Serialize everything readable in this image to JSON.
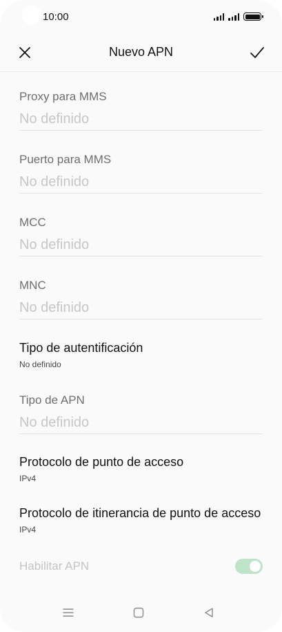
{
  "status_bar": {
    "time": "10:00"
  },
  "app_bar": {
    "title": "Nuevo APN",
    "close_icon": "close-icon",
    "confirm_icon": "check-icon"
  },
  "fields": [
    {
      "label": "Proxy para MMS",
      "placeholder": "No definido"
    },
    {
      "label": "Puerto para MMS",
      "placeholder": "No definido"
    },
    {
      "label": "MCC",
      "placeholder": "No definido"
    },
    {
      "label": "MNC",
      "placeholder": "No definido"
    }
  ],
  "auth_type": {
    "label": "Tipo de autentificación",
    "value": "No definido"
  },
  "apn_type": {
    "label": "Tipo de APN",
    "placeholder": "No definido"
  },
  "protocol": {
    "label": "Protocolo de punto de acceso",
    "value": "IPv4"
  },
  "roaming_protocol": {
    "label": "Protocolo de itinerancia de punto de acceso",
    "value": "IPv4"
  },
  "enable_apn": {
    "label": "Habilitar APN",
    "enabled": true
  },
  "nav_bar": {
    "menu_icon": "menu-icon",
    "home_icon": "home-icon",
    "back_icon": "back-icon"
  },
  "colors": {
    "toggle_track": "#bfe3c8",
    "background": "#fafafa"
  }
}
